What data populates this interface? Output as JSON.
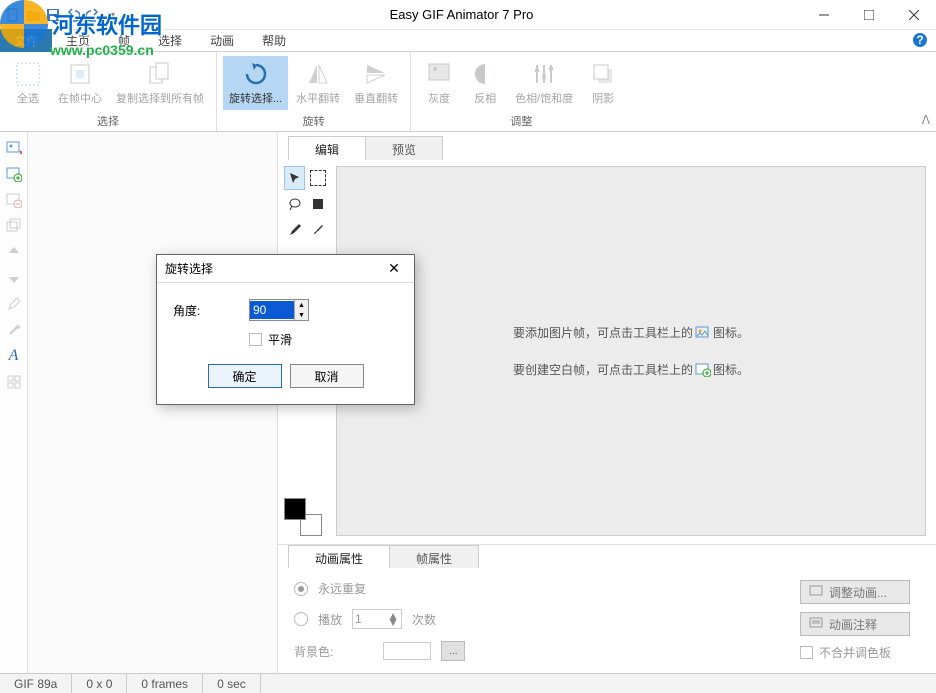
{
  "watermark": {
    "text": "河东软件园",
    "url": "www.pc0359.cn"
  },
  "title": "Easy GIF Animator 7 Pro",
  "menu": {
    "file": "文件",
    "home": "主页",
    "frame": "帧",
    "select": "选择",
    "anim": "动画",
    "help": "帮助"
  },
  "ribbon": {
    "group_select": "选择",
    "group_rotate": "旋转",
    "group_adjust": "调整",
    "select_all": "全选",
    "center_frame": "在帧中心",
    "copy_sel_all": "复制选择到所有帧",
    "rotate_sel": "旋转选择...",
    "flip_h": "水平翻转",
    "flip_v": "垂直翻转",
    "grayscale": "灰度",
    "invert": "反相",
    "hue_sat": "色相/饱和度",
    "shadow": "阴影"
  },
  "tabs": {
    "edit": "编辑",
    "preview": "预览"
  },
  "canvas": {
    "hint1a": "要添加图片帧，可点击工具栏上的",
    "hint1b": "图标。",
    "hint2a": "要创建空白帧，可点击工具栏上的",
    "hint2b": "图标。"
  },
  "props": {
    "tab_anim": "动画属性",
    "tab_frame": "帧属性",
    "repeat_forever": "永远重复",
    "play": "播放",
    "play_count": "1",
    "times": "次数",
    "bgcolor": "背景色:",
    "adjust_anim": "调整动画...",
    "anim_notes": "动画注释",
    "no_merge_palette": "不合并调色板"
  },
  "dialog": {
    "title": "旋转选择",
    "angle": "角度:",
    "angle_value": "90",
    "smooth": "平滑",
    "ok": "确定",
    "cancel": "取消"
  },
  "status": {
    "format": "GIF 89a",
    "size": "0 x 0",
    "frames": "0 frames",
    "duration": "0 sec"
  }
}
